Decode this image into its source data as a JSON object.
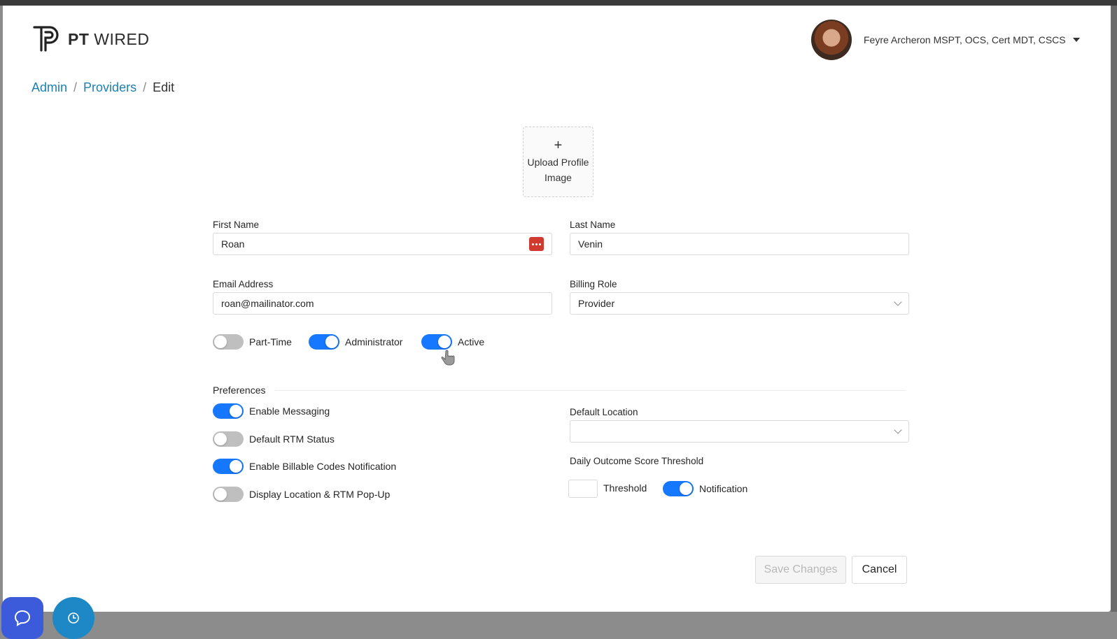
{
  "brand": {
    "bold": "PT",
    "light": "WIRED"
  },
  "user": {
    "name": "Feyre Archeron MSPT, OCS, Cert MDT, CSCS"
  },
  "breadcrumb": {
    "admin": "Admin",
    "providers": "Providers",
    "current": "Edit",
    "separator": "/"
  },
  "upload": {
    "plus": "+",
    "line1": "Upload Profile",
    "line2": "Image"
  },
  "form": {
    "first_name_label": "First Name",
    "first_name_value": "Roan",
    "last_name_label": "Last Name",
    "last_name_value": "Venin",
    "email_label": "Email Address",
    "email_value": "roan@mailinator.com",
    "billing_role_label": "Billing Role",
    "billing_role_value": "Provider"
  },
  "status_toggles": [
    {
      "label": "Part-Time",
      "on": false
    },
    {
      "label": "Administrator",
      "on": true
    },
    {
      "label": "Active",
      "on": true
    }
  ],
  "preferences": {
    "title": "Preferences",
    "toggles": [
      {
        "label": "Enable Messaging",
        "on": true
      },
      {
        "label": "Default RTM Status",
        "on": false
      },
      {
        "label": "Enable Billable Codes Notification",
        "on": true
      },
      {
        "label": "Display Location & RTM Pop-Up",
        "on": false
      }
    ],
    "default_location_label": "Default Location",
    "default_location_value": "",
    "threshold_section_label": "Daily Outcome Score Threshold",
    "threshold_label": "Threshold",
    "notification_label": "Notification",
    "notification_on": true
  },
  "actions": {
    "save": "Save Changes",
    "cancel": "Cancel"
  },
  "colors": {
    "primary": "#1677ff",
    "link": "#1e81b0",
    "chat_fab": "#3b5bdb",
    "help_fab": "#1e88c7"
  }
}
